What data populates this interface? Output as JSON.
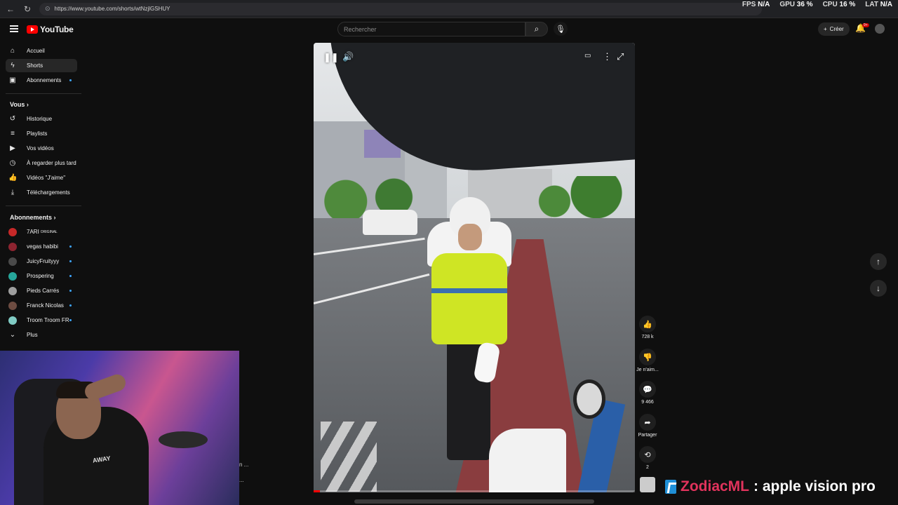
{
  "browser": {
    "url": "https://www.youtube.com/shorts/wtNzjlGSHUY",
    "perf": [
      {
        "label": "FPS",
        "value": "N/A"
      },
      {
        "label": "GPU",
        "value": "36 %"
      },
      {
        "label": "CPU",
        "value": "16 %"
      },
      {
        "label": "LAT",
        "value": "N/A"
      }
    ]
  },
  "header": {
    "logo_text": "YouTube",
    "search_placeholder": "Rechercher",
    "create_label": "Créer",
    "notif_badge": "9+"
  },
  "sidebar": {
    "main": [
      {
        "label": "Accueil",
        "icon": "home-icon"
      },
      {
        "label": "Shorts",
        "icon": "shorts-icon"
      },
      {
        "label": "Abonnements",
        "icon": "subscriptions-icon"
      }
    ],
    "you_title": "Vous",
    "you": [
      {
        "label": "Historique",
        "icon": "history-icon"
      },
      {
        "label": "Playlists",
        "icon": "playlist-icon"
      },
      {
        "label": "Vos vidéos",
        "icon": "video-icon"
      },
      {
        "label": "À regarder plus tard",
        "icon": "clock-icon"
      },
      {
        "label": "Vidéos \"J'aime\"",
        "icon": "like-icon"
      },
      {
        "label": "Téléchargements",
        "icon": "download-icon"
      }
    ],
    "subs_title": "Abonnements",
    "subs": [
      {
        "label": "7ARI",
        "color": "#c62828",
        "tag": "ORIGINAL"
      },
      {
        "label": "vegas habibi",
        "color": "#8e2430"
      },
      {
        "label": "JuicyFruityyy",
        "color": "#4a4a4a"
      },
      {
        "label": "Prospering",
        "color": "#26a69a"
      },
      {
        "label": "Pieds Carrés",
        "color": "#9e9e9e"
      },
      {
        "label": "Franck Nicolas",
        "color": "#6d4c41"
      },
      {
        "label": "Troom Troom FR",
        "color": "#80cbc4"
      }
    ],
    "more_label": "Plus"
  },
  "actions": {
    "likes": "728 k",
    "dislike_label": "Je n'aim...",
    "comments": "9 466",
    "share_label": "Partager",
    "remix": "2"
  },
  "video": {
    "progress": 0.02
  },
  "banner": {
    "name": "ZodiacML",
    "text": ": apple vision pro"
  },
  "webcam": {
    "shirt_text": "AWAY"
  },
  "ghost": [
    "n ...",
    "..."
  ]
}
